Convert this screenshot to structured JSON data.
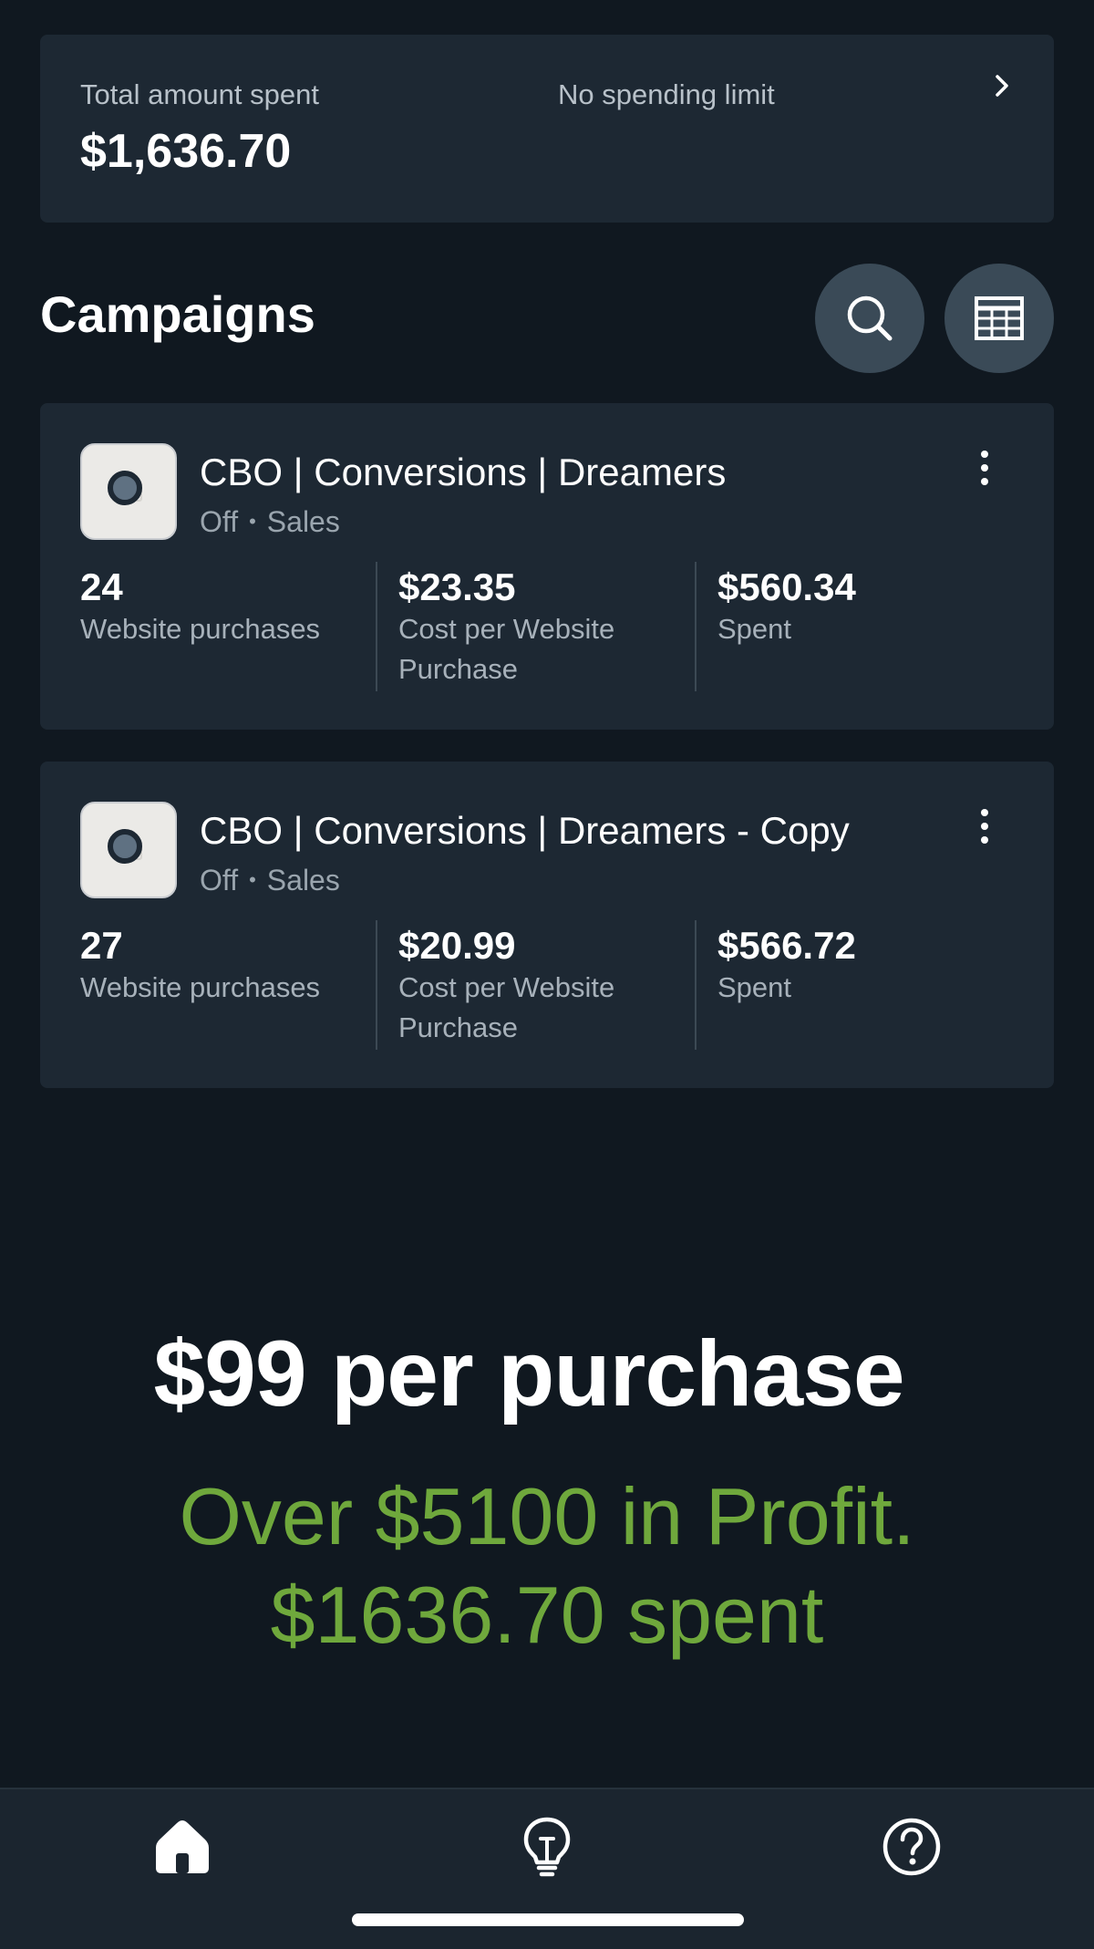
{
  "summary": {
    "total_label": "Total amount spent",
    "total_value": "$1,636.70",
    "limit_label": "No spending limit"
  },
  "campaigns_title": "Campaigns",
  "campaigns": [
    {
      "name": "CBO | Conversions | Dreamers",
      "status": "Off",
      "objective": "Sales",
      "metrics": [
        {
          "value": "24",
          "label": "Website purchases"
        },
        {
          "value": "$23.35",
          "label": "Cost per Website Purchase"
        },
        {
          "value": "$560.34",
          "label": "Spent"
        }
      ]
    },
    {
      "name": "CBO | Conversions | Dreamers - Copy",
      "status": "Off",
      "objective": "Sales",
      "metrics": [
        {
          "value": "27",
          "label": "Website purchases"
        },
        {
          "value": "$20.99",
          "label": "Cost per Website Purchase"
        },
        {
          "value": "$566.72",
          "label": "Spent"
        }
      ]
    }
  ],
  "overlay": {
    "heading": "$99 per purchase",
    "line1": "Over $5100 in Profit.",
    "line2": "$1636.70 spent"
  },
  "icons": {
    "summary_arrow": "chevron-right-icon",
    "search": "search-icon",
    "table": "table-icon",
    "more": "more-vertical-icon",
    "home": "home-icon",
    "tips": "lightbulb-icon",
    "help": "help-icon"
  },
  "colors": {
    "background": "#101820",
    "card": "#1d2833",
    "overlay_green": "#6fa83c"
  }
}
